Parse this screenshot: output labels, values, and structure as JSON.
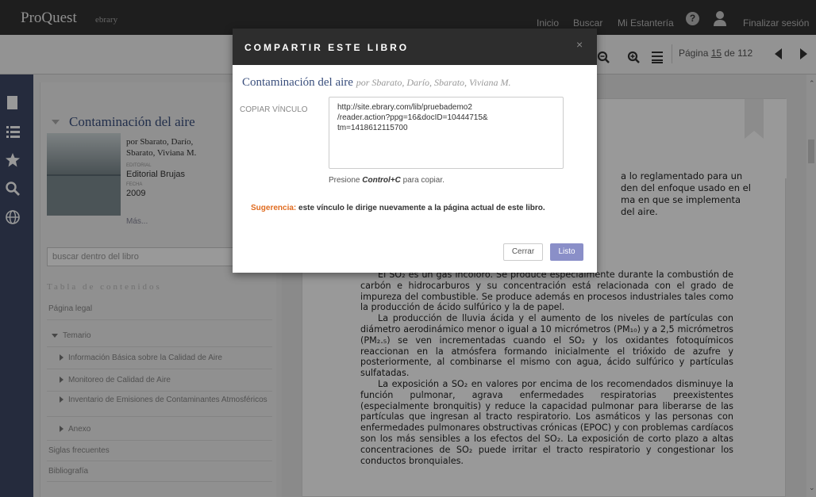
{
  "topbar": {
    "brand": "ProQuest",
    "brand_sub": "ebrary",
    "nav": [
      "Inicio",
      "Buscar",
      "Mi Estantería",
      "Finalizar sesión"
    ]
  },
  "toolbar": {
    "page_prefix": "Página ",
    "page_current": "15",
    "page_total": " de 112"
  },
  "sidebar": {
    "book_title": "Contaminación del aire",
    "author": "por Sbarato, Darío, Sbarato, Viviana M.",
    "publisher_label": "EDITORIAL",
    "publisher": "Editorial Brujas",
    "date_label": "FECHA",
    "date": "2009",
    "more": "Más...",
    "search_placeholder": "buscar dentro del libro",
    "toc_title": "Tabla de contenidos",
    "toc": [
      "Página legal",
      "Temario",
      "Información Básica sobre la Calidad de Aire",
      "Monitoreo de Calidad de Aire",
      "Inventario de Emisiones de Contaminantes Atmosféricos",
      "Anexo",
      "Siglas frecuentes",
      "Bibliografía"
    ]
  },
  "reader": {
    "frag_1": "a lo reglamentado para un",
    "frag_2": "den del enfoque usado en el",
    "frag_3": "ma en que se implementa",
    "frag_4": "del aire.",
    "paragraphs": [
      "El SO₂ es un gas incoloro. Se produce especialmente durante la combustión de carbón e hidrocarburos y su concentración está relacionada con el grado de impureza del combustible. Se produce además en procesos industriales tales como la producción de ácido sulfúrico y la de papel.",
      "La producción de lluvia ácida y el aumento de los niveles de partículas con diámetro aerodinámico menor o igual a 10 micrómetros (PM₁₀) y a 2,5 micrómetros (PM₂.₅) se ven incrementadas cuando el SO₂ y los oxidantes fotoquímicos reaccionan en la atmósfera formando inicialmente el trióxido de azufre y posteriormente, al combinarse el mismo con agua, ácido sulfúrico y partículas sulfatadas.",
      "La exposición a SO₂ en valores por encima de los recomendados disminuye la función pulmonar, agrava enfermedades respiratorias preexistentes (especialmente bronquitis) y reduce la capacidad pulmonar para liberarse de las partículas que ingresan al tracto respiratorio. Los asmáticos y las personas con enfermedades pulmonares obstructivas crónicas (EPOC) y con problemas cardíacos son los más sensibles a los efectos del SO₂. La exposición de corto plazo a altas concentraciones de SO₂ puede irritar el tracto respiratorio y congestionar los conductos bronquiales."
    ]
  },
  "modal": {
    "title": "COMPARTIR ESTE LIBRO",
    "close": "×",
    "book_title": "Contaminación del aire ",
    "book_author": "por Sbarato, Darío, Sbarato, Viviana M.",
    "copy_label": "COPIAR VÍNCULO",
    "link": "http://site.ebrary.com/lib/pruebademo2\n/reader.action?ppg=16&docID=10444715&\ntm=1418612115700",
    "hint_pre": "Presione ",
    "hint_key": "Control+C",
    "hint_post": " para copiar.",
    "tip_label": "Sugerencia:",
    "tip_text": " este vínculo le dirige nuevamente a la página actual de este libro.",
    "btn_close": "Cerrar",
    "btn_done": "Listo"
  }
}
